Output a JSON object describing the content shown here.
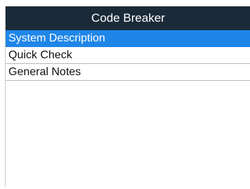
{
  "title": "Code Breaker",
  "menu": {
    "selected_index": 0,
    "items": [
      {
        "label": "System Description"
      },
      {
        "label": "Quick Check"
      },
      {
        "label": "General Notes"
      }
    ]
  },
  "colors": {
    "title_bar": "#1b2a38",
    "selection": "#1f86e8",
    "background": "#ffffff"
  }
}
